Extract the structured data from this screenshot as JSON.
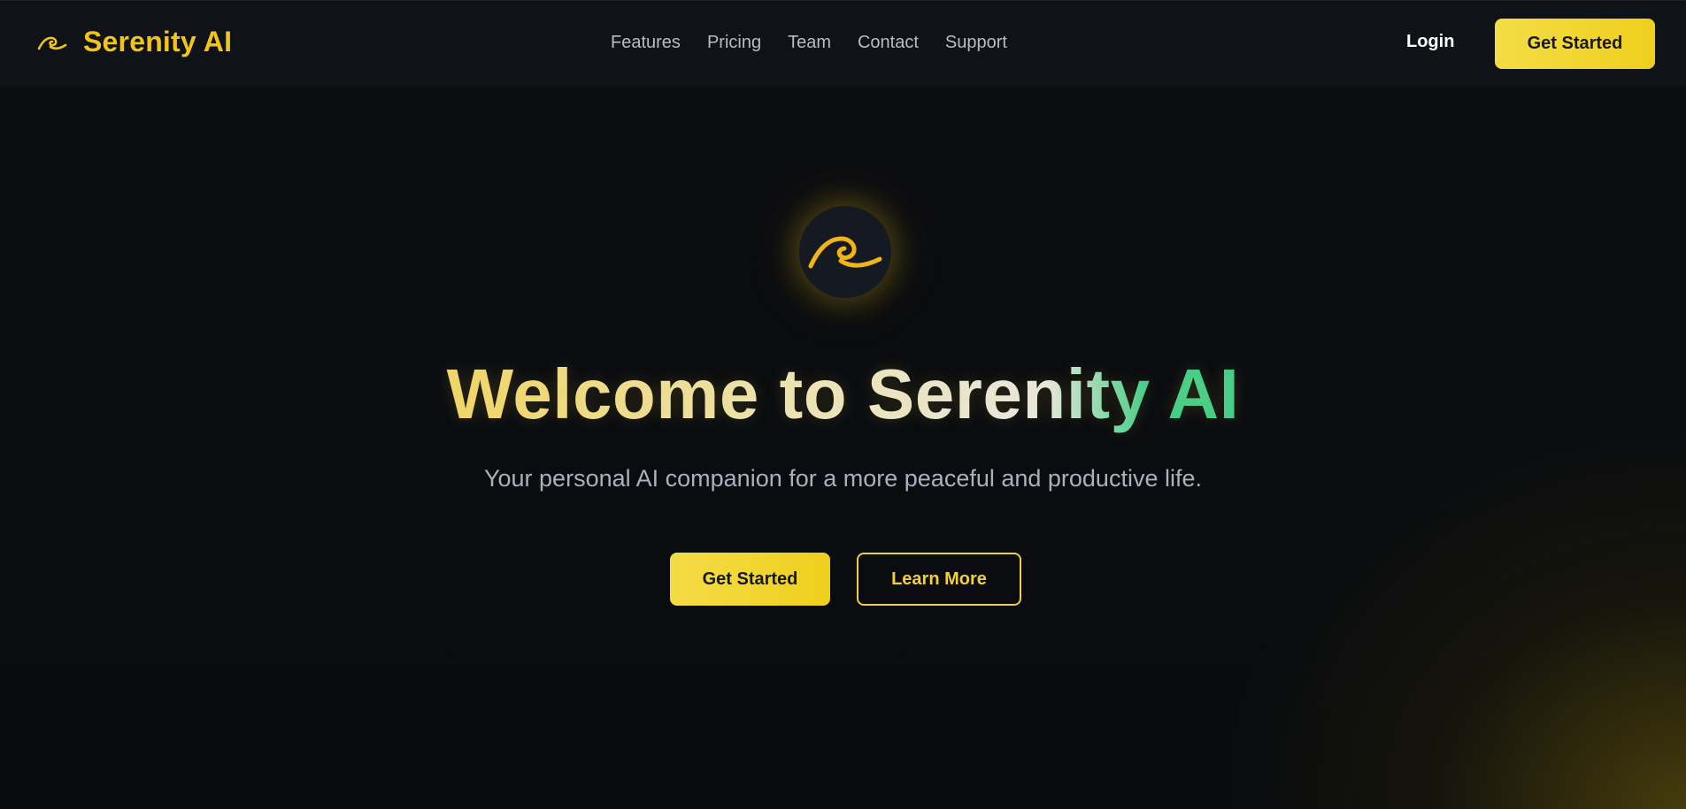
{
  "header": {
    "brand_name": "Serenity AI",
    "brand_icon": "wave-icon",
    "nav": {
      "features": "Features",
      "pricing": "Pricing",
      "team": "Team",
      "contact": "Contact",
      "support": "Support"
    },
    "login_label": "Login",
    "cta_label": "Get Started"
  },
  "hero": {
    "logo_icon": "wave-icon",
    "title": "Welcome to Serenity AI",
    "subtitle": "Your personal AI companion for a more peaceful and productive life.",
    "primary_label": "Get Started",
    "secondary_label": "Learn More"
  },
  "colors": {
    "accent": "#f0c419",
    "background": "#0a0c0f",
    "header_bg": "#0f1217",
    "title_gradient_end": "#2fd48c",
    "muted_text": "#aab0bc"
  }
}
